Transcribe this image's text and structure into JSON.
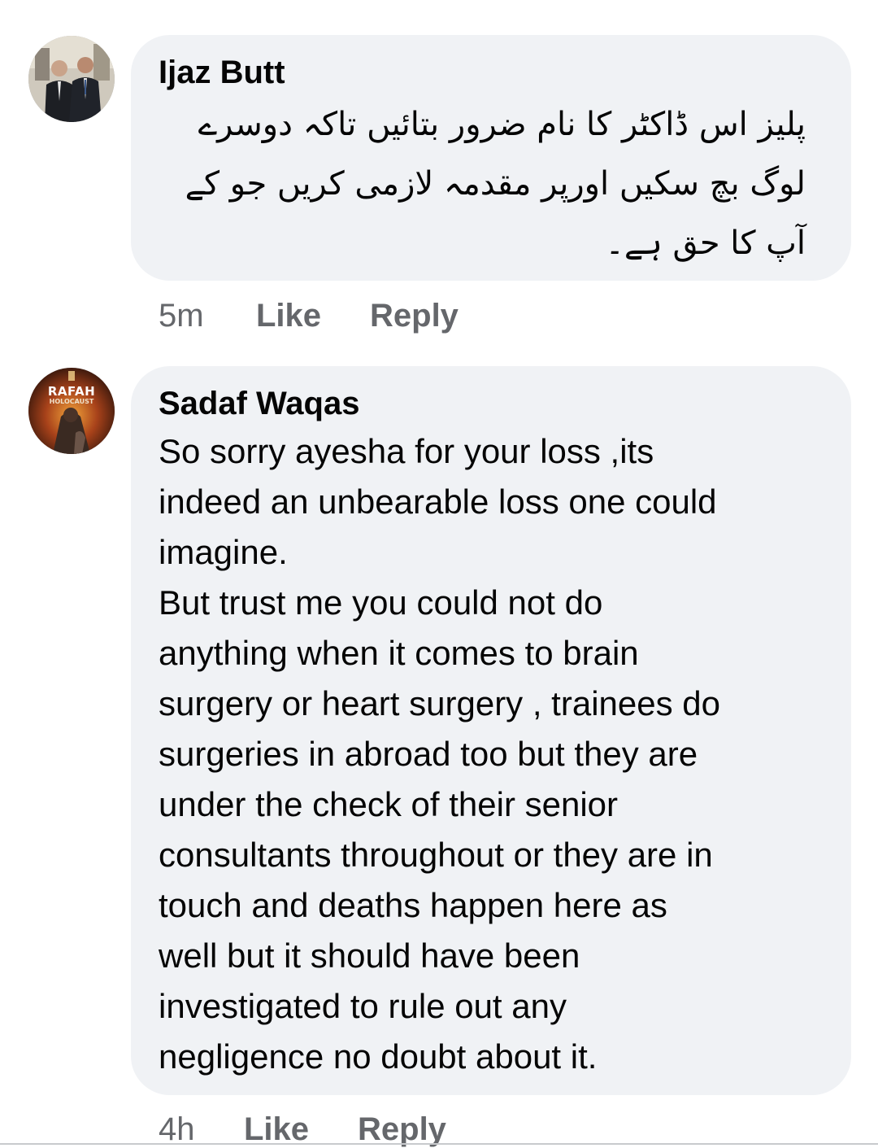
{
  "comments": [
    {
      "author": "Ijaz Butt",
      "text": "پلیز اس ڈاکٹر کا نام ضرور بتائیں تاکہ دوسرے لوگ بچ سکیں اورپر مقدمہ لازمی کریں جو کے آپ کا حق ہے۔",
      "time": "5m",
      "like_label": "Like",
      "reply_label": "Reply",
      "avatar_icon": "profile-photo-two-men-suits"
    },
    {
      "author": "Sadaf Waqas",
      "text": "So sorry ayesha for your loss ,its\nindeed an unbearable loss one could\nimagine.\nBut trust me you could not do\nanything when it comes to brain\nsurgery or heart surgery , trainees do\nsurgeries in abroad too but they are\nunder the check of their senior\nconsultants throughout or they are in\ntouch and deaths happen here as\nwell but it should have been\ninvestigated to rule out any\nnegligence no doubt about it.",
      "time": "4h",
      "like_label": "Like",
      "reply_label": "Reply",
      "avatar_icon": "profile-photo-rafah-holocaust",
      "avatar_text_1": "RAFAH",
      "avatar_text_2": "HOLOCAUST"
    }
  ],
  "colors": {
    "bubble": "#f0f2f5",
    "meta": "#65676b",
    "text": "#050505"
  }
}
